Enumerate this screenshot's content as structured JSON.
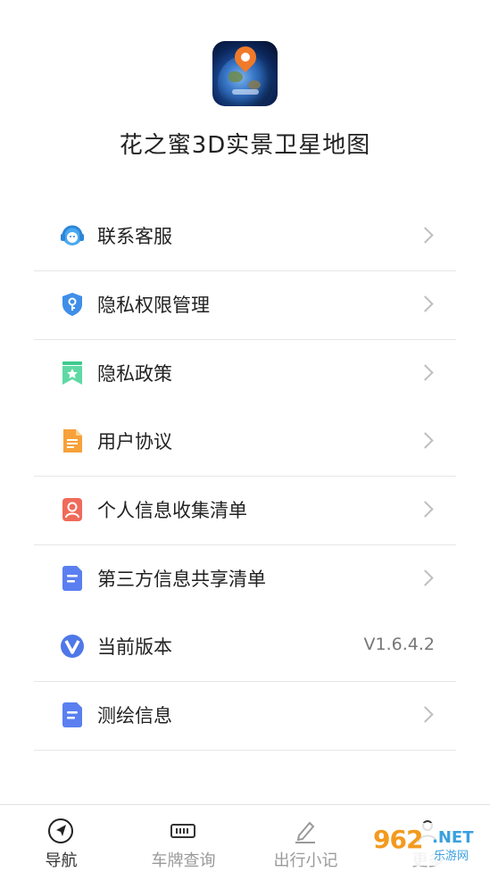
{
  "app": {
    "title": "花之蜜3D实景卫星地图"
  },
  "menu": [
    {
      "label": "联系客服",
      "icon": "headset-icon"
    },
    {
      "label": "隐私权限管理",
      "icon": "shield-key-icon"
    },
    {
      "label": "隐私政策",
      "icon": "bookmark-star-icon"
    },
    {
      "label": "用户协议",
      "icon": "document-icon"
    },
    {
      "label": "个人信息收集清单",
      "icon": "person-card-icon"
    },
    {
      "label": "第三方信息共享清单",
      "icon": "doc-lines-icon"
    },
    {
      "label": "当前版本",
      "icon": "version-v-icon",
      "value": "V1.6.4.2"
    },
    {
      "label": "测绘信息",
      "icon": "doc-lines-icon"
    }
  ],
  "tabs": [
    {
      "label": "导航",
      "icon": "navigation-arrow-icon",
      "active": true
    },
    {
      "label": "车牌查询",
      "icon": "license-plate-icon",
      "active": false
    },
    {
      "label": "出行小记",
      "icon": "pencil-note-icon",
      "active": false
    },
    {
      "label": "更多",
      "icon": "person-icon",
      "active": false
    }
  ],
  "watermark": {
    "brand": "962",
    "net": ".NET",
    "sub": "乐游网"
  },
  "colors": {
    "text": "#222222",
    "chevron": "#bfbfbf",
    "divider": "#e6e6e6",
    "tab_inactive": "#9a9a9a"
  }
}
